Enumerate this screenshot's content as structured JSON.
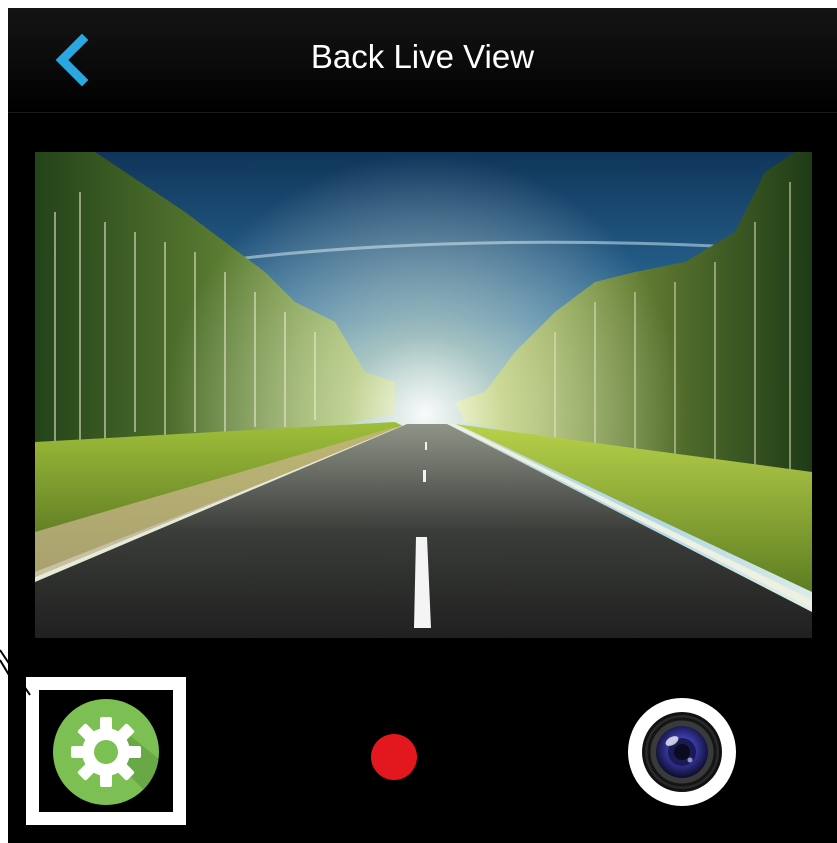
{
  "header": {
    "title": "Back Live View",
    "back_icon": "chevron-left-icon"
  },
  "live_view": {
    "content": "road-through-forest-camera-feed"
  },
  "controls": {
    "settings_icon": "gear-icon",
    "record_icon": "record-dot-icon",
    "capture_icon": "camera-lens-icon"
  },
  "colors": {
    "accent_back": "#2aa7e0",
    "settings_green": "#7cbf53",
    "record_red": "#e3181e",
    "background": "#000000"
  }
}
